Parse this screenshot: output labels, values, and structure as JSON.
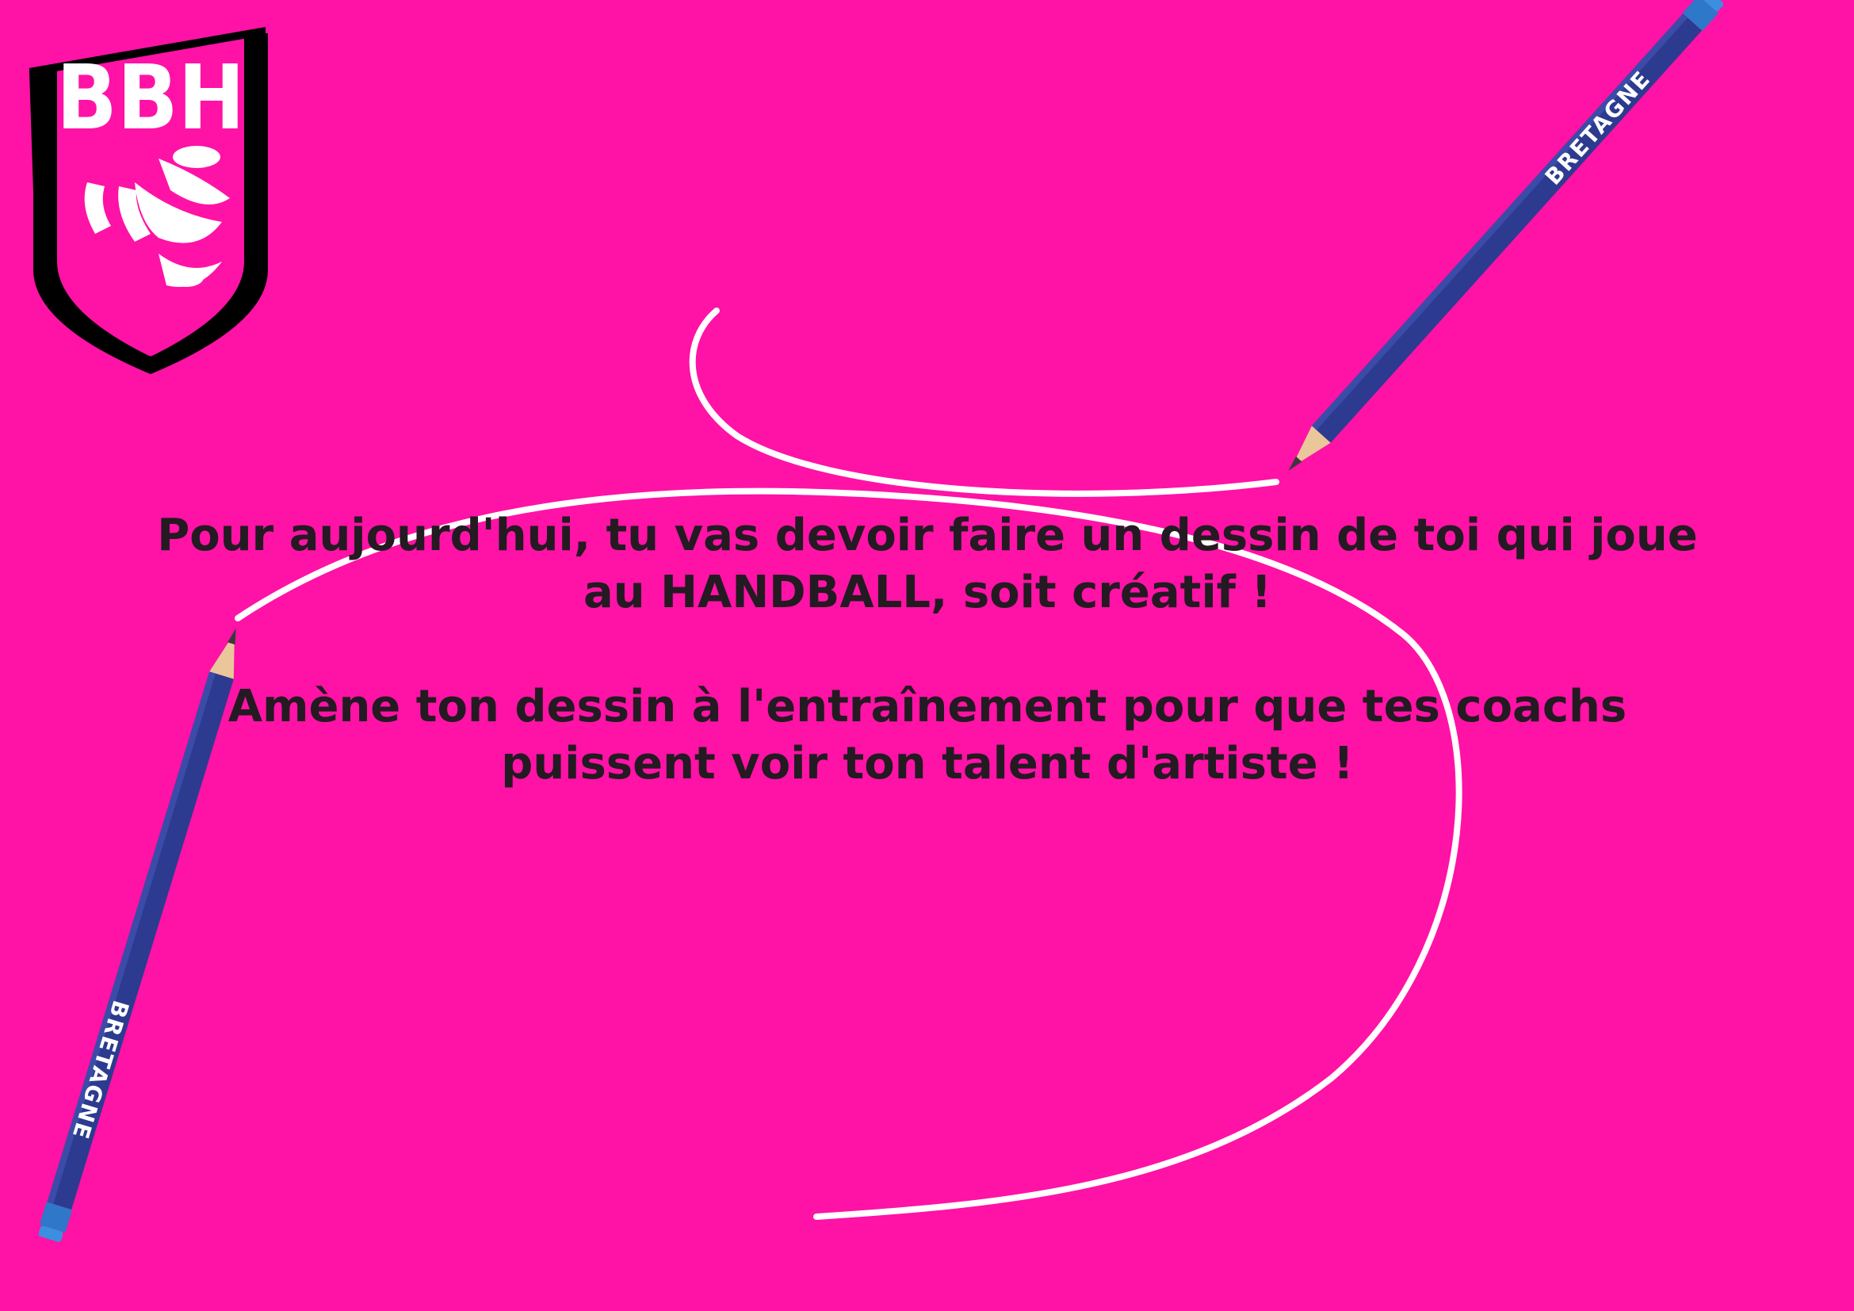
{
  "logo": {
    "text": "BBH"
  },
  "message": {
    "line1": "Pour aujourd'hui, tu vas devoir faire un dessin de toi qui joue",
    "line2": "au HANDBALL, soit créatif !",
    "line3": "Amène ton dessin à l'entraînement pour que tes coachs",
    "line4": "puissent voir ton talent d'artiste !"
  },
  "pencils": {
    "brand": "BRETAGNE"
  },
  "colors": {
    "background": "#ff12a6",
    "text": "#241a22",
    "pencil": "#2c3b8f",
    "line": "#ffffff"
  }
}
